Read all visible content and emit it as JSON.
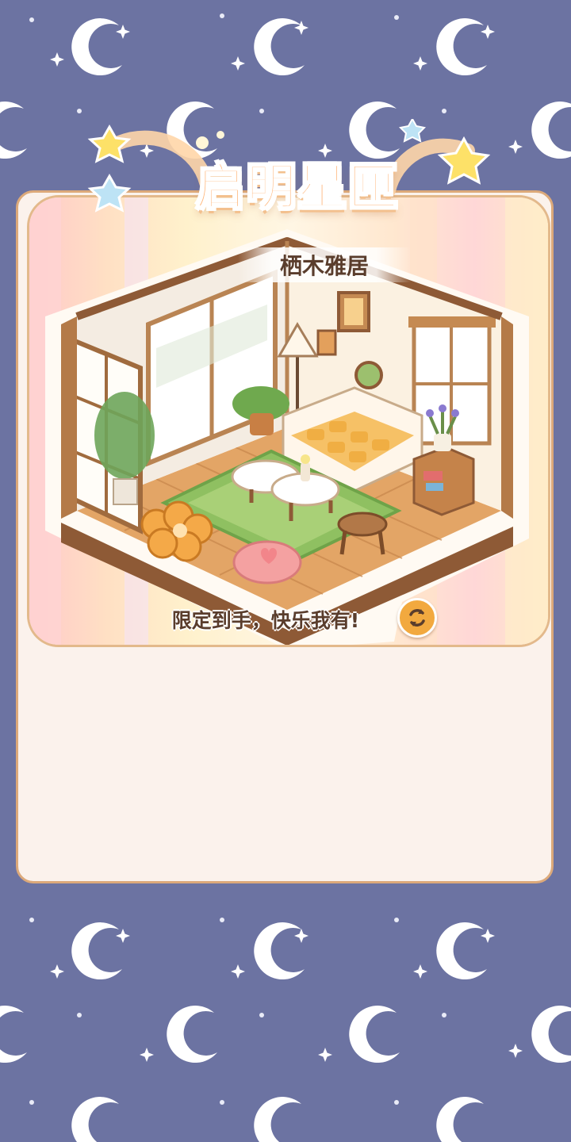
{
  "banner": {
    "title": "启明星匣"
  },
  "room": {
    "name": "栖木雅居"
  },
  "slogan": "限定到手，快乐我有!",
  "icons": {
    "refresh": "refresh-icon",
    "stars": "star-icon",
    "background": "moon-icon"
  },
  "colors": {
    "background": "#6c73a2",
    "panel": "#fbf2ec",
    "panel_border": "#dca97a",
    "title": "#ffb67a",
    "refresh_button": "#f2a93f"
  }
}
